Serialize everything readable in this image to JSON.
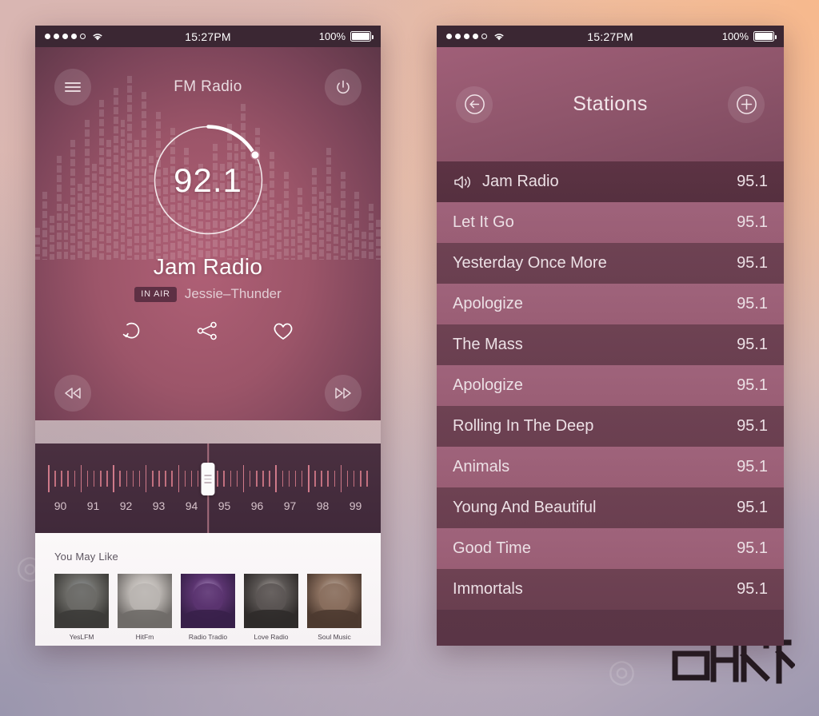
{
  "statusbar": {
    "time": "15:27PM",
    "battery_text": "100%",
    "signal_dots": 5,
    "signal_filled": 4,
    "wifi_icon": "wifi-icon",
    "battery_icon": "battery-icon"
  },
  "player": {
    "nav": {
      "title": "FM Radio",
      "menu_icon": "hamburger-menu-icon",
      "power_icon": "power-icon"
    },
    "dial": {
      "frequency": "92.1",
      "progress_pct": 18
    },
    "track": {
      "title": "Jam Radio",
      "badge": "IN AIR",
      "artist": "Jessie–Thunder"
    },
    "controls": {
      "prev_icon": "rewind-icon",
      "next_icon": "fast-forward-icon",
      "repeat_icon": "repeat-icon",
      "share_icon": "share-icon",
      "favorite_icon": "heart-icon"
    },
    "tuner": {
      "current": "92",
      "scale": [
        "90",
        "91",
        "92",
        "93",
        "94",
        "95",
        "96",
        "97",
        "98",
        "99"
      ]
    },
    "you_may_like": {
      "title": "You May Like",
      "items": [
        {
          "label": "YesLFM"
        },
        {
          "label": "HitFm"
        },
        {
          "label": "Radio Tradio"
        },
        {
          "label": "Love Radio"
        },
        {
          "label": "Soul Music"
        }
      ]
    }
  },
  "stations": {
    "nav": {
      "title": "Stations",
      "back_icon": "back-arrow-icon",
      "add_icon": "plus-icon"
    },
    "rows": [
      {
        "name": "Jam Radio",
        "freq": "95.1",
        "selected": true,
        "icon": "speaker-icon"
      },
      {
        "name": "Let It Go",
        "freq": "95.1",
        "selected": false,
        "icon": ""
      },
      {
        "name": "Yesterday Once More",
        "freq": "95.1",
        "selected": false,
        "icon": ""
      },
      {
        "name": "Apologize",
        "freq": "95.1",
        "selected": false,
        "icon": ""
      },
      {
        "name": "The Mass",
        "freq": "95.1",
        "selected": false,
        "icon": ""
      },
      {
        "name": "Apologize",
        "freq": "95.1",
        "selected": false,
        "icon": ""
      },
      {
        "name": "Rolling In The Deep",
        "freq": "95.1",
        "selected": false,
        "icon": ""
      },
      {
        "name": "Animals",
        "freq": "95.1",
        "selected": false,
        "icon": ""
      },
      {
        "name": "Young And Beautiful",
        "freq": "95.1",
        "selected": false,
        "icon": ""
      },
      {
        "name": "Good Time",
        "freq": "95.1",
        "selected": false,
        "icon": ""
      },
      {
        "name": "Immortals",
        "freq": "95.1",
        "selected": false,
        "icon": ""
      }
    ]
  },
  "colors": {
    "accent": "#a05f78",
    "hero_rose": "#9c5569",
    "statusbar": "#3b2733",
    "tuner_bg": "#452c3c",
    "panel_light": "#fbf8f9"
  },
  "watermark": {
    "mark": "古朋村"
  }
}
